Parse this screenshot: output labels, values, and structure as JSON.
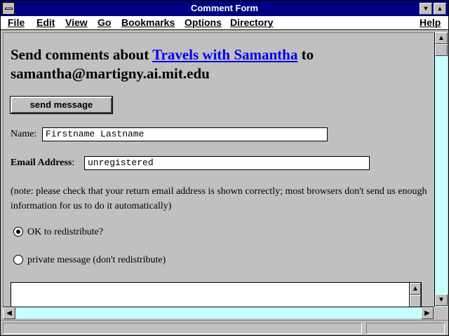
{
  "window": {
    "title": "Comment Form"
  },
  "menu": {
    "file": "File",
    "edit": "Edit",
    "view": "View",
    "go": "Go",
    "bookmarks": "Bookmarks",
    "options": "Options",
    "directory": "Directory",
    "help": "Help"
  },
  "form": {
    "heading_prefix": "Send comments about ",
    "heading_link": "Travels with Samantha",
    "heading_suffix": " to samantha@martigny.ai.mit.edu",
    "send_button": "send message",
    "name_label": "Name:",
    "name_value": "Firstname Lastname",
    "email_label": "Email Address",
    "email_colon": ":",
    "email_value": "unregistered",
    "note": "(note: please check that your return email address is shown correctly; most browsers don't send us enough information for us to do it automatically)",
    "radio_ok_label": "OK to redistribute?",
    "radio_ok_checked": true,
    "radio_private_label": "private message (don't redistribute)",
    "radio_private_checked": false,
    "message_value": ""
  },
  "icons": {
    "system_menu": "system-menu-icon",
    "minimize": "minimize-icon",
    "maximize": "maximize-icon",
    "scroll_up": "arrow-up-icon",
    "scroll_down": "arrow-down-icon",
    "scroll_left": "arrow-left-icon",
    "scroll_right": "arrow-right-icon"
  },
  "colors": {
    "title_bar": "#000080",
    "link": "#0000ee",
    "scroll_track": "#c8ffff",
    "background": "#c0c0c0"
  }
}
